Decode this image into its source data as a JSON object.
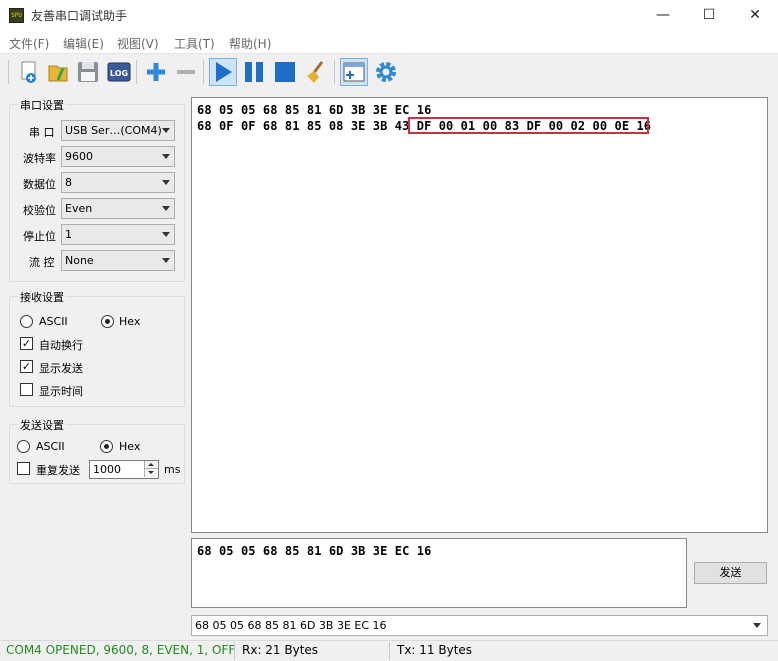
{
  "window": {
    "title": "友善串口调试助手",
    "app_icon_text": "SPU",
    "minimize": "—",
    "maximize": "☐",
    "close": "✕"
  },
  "menu": [
    "文件(F)",
    "编辑(E)",
    "视图(V)",
    "工具(T)",
    "帮助(H)"
  ],
  "toolbar": {
    "log_label": "LOG",
    "icons": [
      "new-icon",
      "open-icon",
      "save-icon",
      "log-icon",
      "add-icon",
      "remove-icon",
      "play-icon",
      "pause-icon",
      "stop-icon",
      "clear-icon",
      "window-icon",
      "settings-icon"
    ]
  },
  "serial": {
    "group_title": "串口设置",
    "port_label": "串 口",
    "port_value": "USB Ser…(COM4)",
    "baud_label": "波特率",
    "baud_value": "9600",
    "data_label": "数据位",
    "data_value": "8",
    "parity_label": "校验位",
    "parity_value": "Even",
    "stop_label": "停止位",
    "stop_value": "1",
    "flow_label": "流 控",
    "flow_value": "None"
  },
  "receive": {
    "group_title": "接收设置",
    "ascii_label": "ASCII",
    "hex_label": "Hex",
    "mode_selected": "Hex",
    "auto_wrap_label": "自动换行",
    "auto_wrap_checked": true,
    "show_send_label": "显示发送",
    "show_send_checked": true,
    "show_time_label": "显示时间",
    "show_time_checked": false
  },
  "send_settings": {
    "group_title": "发送设置",
    "ascii_label": "ASCII",
    "hex_label": "Hex",
    "mode_selected": "Hex",
    "repeat_label": "重复发送",
    "repeat_checked": false,
    "interval_value": "1000",
    "interval_unit": "ms"
  },
  "rx": {
    "line1": "68 05 05 68 85 81 6D 3B 3E EC 16",
    "line2_prefix": "68 0F 0F 68 81 85 08 3E 3B ",
    "line2_highlight": "43 DF 00 01 00 83 DF 00 02 00",
    "line2_suffix": " 0E 16",
    "highlight_color": "#c8323c"
  },
  "tx": {
    "text": "68 05 05 68 85 81 6D 3B 3E EC 16",
    "send_label": "发送",
    "history_value": "68 05 05 68 85 81 6D 3B 3E EC 16"
  },
  "status": {
    "connection": "COM4 OPENED, 9600, 8, EVEN, 1, OFF",
    "connection_color": "#228b22",
    "rx": "Rx: 21 Bytes",
    "tx": "Tx: 11 Bytes"
  }
}
